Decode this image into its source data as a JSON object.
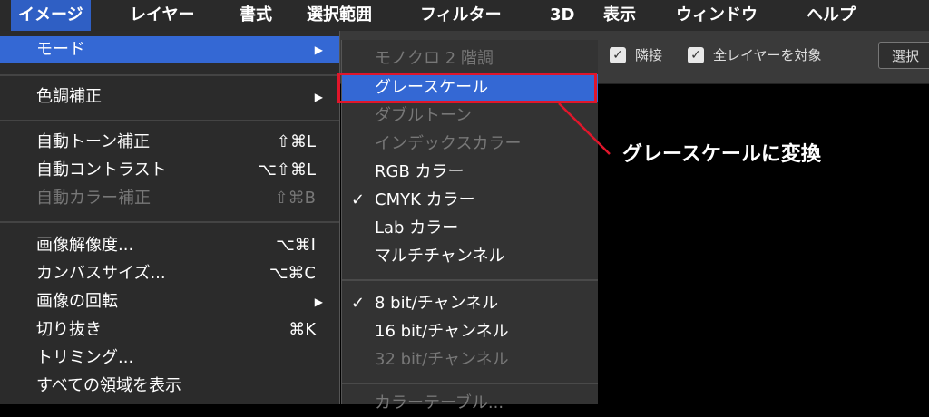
{
  "menubar": {
    "items": [
      "イメージ",
      "レイヤー",
      "書式",
      "選択範囲",
      "フィルター",
      "3D",
      "表示",
      "ウィンドウ",
      "ヘルプ"
    ]
  },
  "toolbar": {
    "adjacent_label": "隣接",
    "all_layers_label": "全レイヤーを対象",
    "select_button": "選択"
  },
  "image_menu": {
    "mode": "モード",
    "adjustments": "色調補正",
    "auto_tone": {
      "label": "自動トーン補正",
      "shortcut": "⇧⌘L"
    },
    "auto_contrast": {
      "label": "自動コントラスト",
      "shortcut": "⌥⇧⌘L"
    },
    "auto_color": {
      "label": "自動カラー補正",
      "shortcut": "⇧⌘B"
    },
    "image_size": {
      "label": "画像解像度...",
      "shortcut": "⌥⌘I"
    },
    "canvas_size": {
      "label": "カンバスサイズ...",
      "shortcut": "⌥⌘C"
    },
    "image_rotation": "画像の回転",
    "crop": {
      "label": "切り抜き",
      "shortcut": "⌘K"
    },
    "trim": "トリミング...",
    "reveal_all": "すべての領域を表示"
  },
  "mode_submenu": {
    "bitmap": "モノクロ 2 階調",
    "grayscale": "グレースケール",
    "duotone": "ダブルトーン",
    "indexed": "インデックスカラー",
    "rgb": "RGB カラー",
    "cmyk": "CMYK カラー",
    "lab": "Lab カラー",
    "multichannel": "マルチチャンネル",
    "bit8": "8 bit/チャンネル",
    "bit16": "16 bit/チャンネル",
    "bit32": "32 bit/チャンネル",
    "color_table": "カラーテーブル...",
    "checkmark": "✓"
  },
  "annotation": {
    "callout": "グレースケールに変換",
    "color": "#e0162b"
  }
}
